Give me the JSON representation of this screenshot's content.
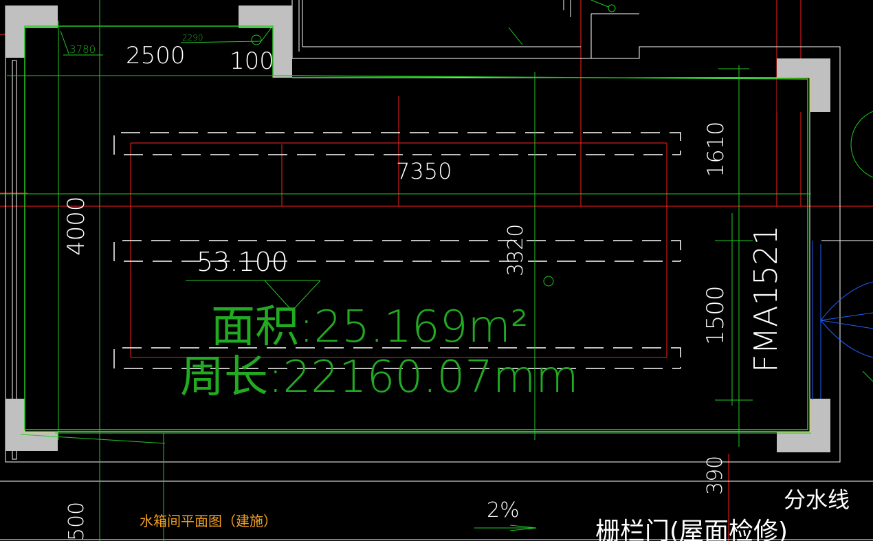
{
  "caption": "水箱间平面图（建施）",
  "dimensions": {
    "d3780": "3780",
    "d2500": "2500",
    "d2290": "2290",
    "d100": "100",
    "d7350": "7350",
    "d1610": "1610",
    "d4000": "4000",
    "d3320": "3320",
    "d1500": "1500",
    "d390": "390",
    "d500": "500"
  },
  "elevation": "53.100",
  "area_text": "面积:25.169m²",
  "perimeter_text": "周长:22160.07mm",
  "door_code": "FMA1521",
  "slope": "2%",
  "divide_line": "分水线",
  "gate_label": "栅栏门(屋面检修)",
  "colors": {
    "background": "#000000",
    "wall": "#ffffff",
    "column": "#c0c0c0",
    "axis": "#ff2020",
    "room_outline": "#22cc22",
    "caption": "#f0a020",
    "door_swing": "#3060ff"
  }
}
